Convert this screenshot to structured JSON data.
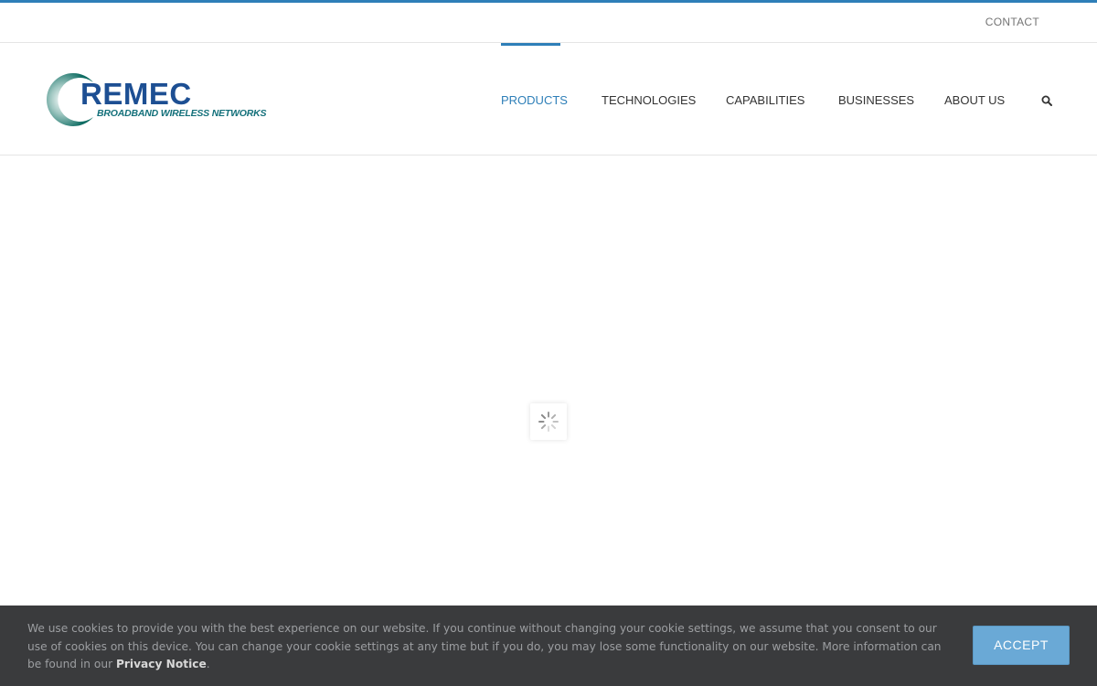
{
  "top_bar": {
    "contact_label": "CONTACT"
  },
  "brand": {
    "name": "REMEC",
    "tagline": "BROADBAND WIRELESS NETWORKS",
    "colors": {
      "wordmark": "#1d4f93",
      "tagline": "#13707a",
      "crescent": "#0f6d63"
    }
  },
  "nav": {
    "items": [
      {
        "label": "PRODUCTS",
        "active": true
      },
      {
        "label": "TECHNOLOGIES",
        "active": false
      },
      {
        "label": "CAPABILITIES",
        "active": false
      },
      {
        "label": "BUSINESSES",
        "active": false
      },
      {
        "label": "ABOUT US",
        "active": false
      }
    ],
    "search_icon": "search-icon"
  },
  "content": {
    "loader_icon": "spinner-icon"
  },
  "cookie_notice": {
    "text": "We use cookies to provide you with the best experience on our website. If you continue without changing your cookie settings, we assume that you consent to our use of cookies on this device. You can change your cookie settings at any time but if you do, you may lose some functionality on our website. More information can be found in our ",
    "link_label": "Privacy Notice",
    "suffix": ".",
    "accept_label": "ACCEPT"
  },
  "colors": {
    "accent": "#2e7fb8",
    "cookie_bar_bg": "#3a3b3d",
    "accept_button_bg": "#6aa9d6"
  }
}
